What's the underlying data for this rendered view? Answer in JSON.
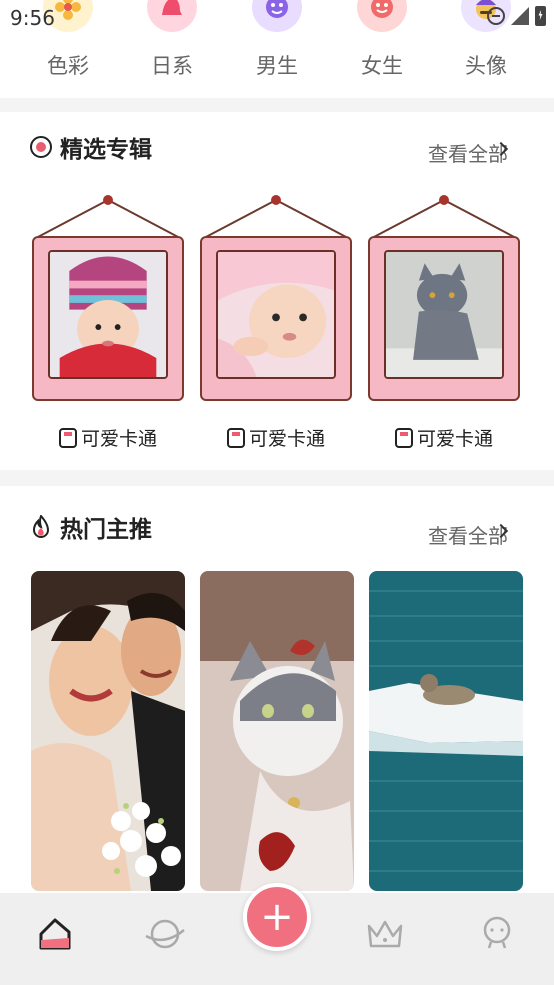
{
  "status_bar": {
    "time": "9:56"
  },
  "categories": [
    {
      "label": "色彩",
      "icon": "flower-icon",
      "color": "#fff3cf"
    },
    {
      "label": "日系",
      "icon": "hat-icon",
      "color": "#ffd6e0"
    },
    {
      "label": "男生",
      "icon": "boy-face-icon",
      "color": "#e8dcff"
    },
    {
      "label": "女生",
      "icon": "girl-face-icon",
      "color": "#ffd6d6"
    },
    {
      "label": "头像",
      "icon": "avatar-icon",
      "color": "#ece3ff"
    }
  ],
  "featured": {
    "title": "精选专辑",
    "more": "查看全部",
    "albums": [
      {
        "label": "可爱卡通",
        "image": "baby-in-knit-hat"
      },
      {
        "label": "可爱卡通",
        "image": "baby-in-towel"
      },
      {
        "label": "可爱卡通",
        "image": "grey-kitten"
      }
    ]
  },
  "hot": {
    "title": "热门主推",
    "more": "查看全部",
    "items": [
      {
        "image": "wedding-couple"
      },
      {
        "image": "white-grey-cat"
      },
      {
        "image": "seal-on-ice"
      }
    ]
  },
  "bottom_nav": {
    "items": [
      "home-icon",
      "planet-icon",
      "add-icon",
      "crown-icon",
      "profile-icon"
    ],
    "accent": "#f1707f"
  }
}
